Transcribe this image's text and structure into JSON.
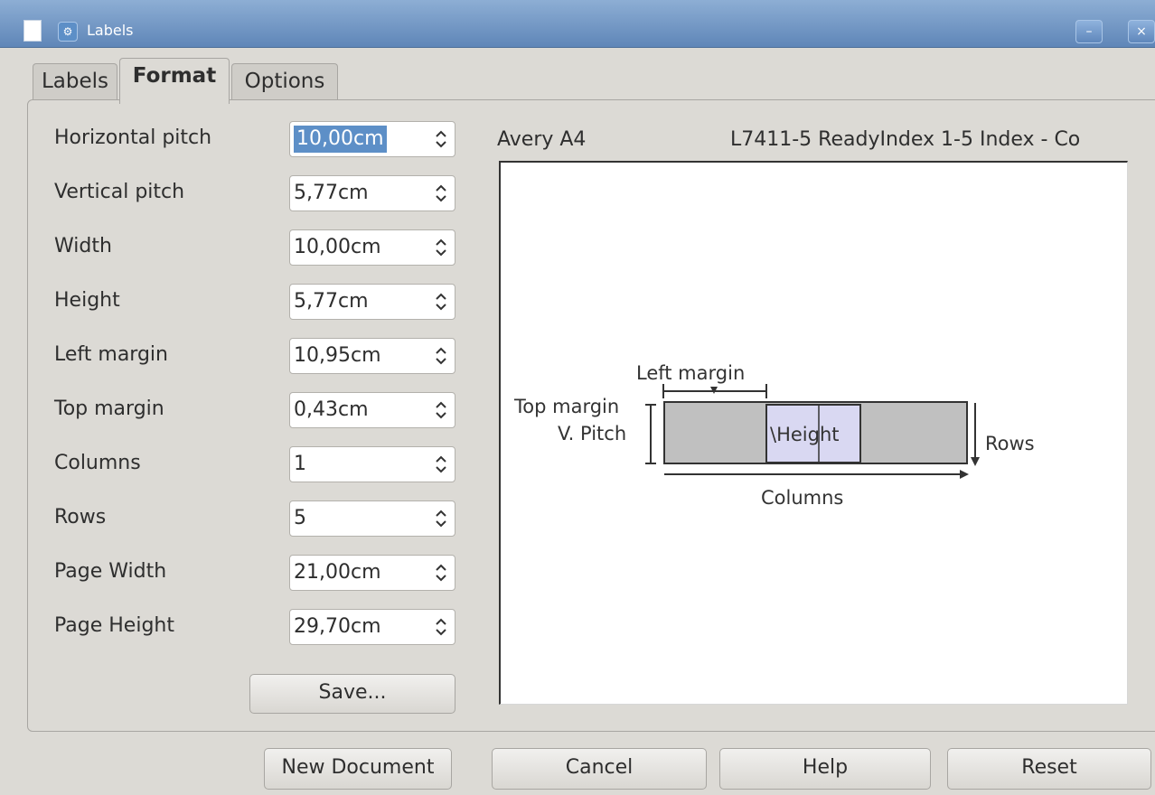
{
  "window": {
    "title": "Labels"
  },
  "tabs": [
    {
      "label": "Labels"
    },
    {
      "label": "Format"
    },
    {
      "label": "Options"
    }
  ],
  "fields": [
    {
      "label": "Horizontal pitch",
      "value": "10,00cm"
    },
    {
      "label": "Vertical pitch",
      "value": "5,77cm"
    },
    {
      "label": "Width",
      "value": "10,00cm"
    },
    {
      "label": "Height",
      "value": "5,77cm"
    },
    {
      "label": "Left margin",
      "value": "10,95cm"
    },
    {
      "label": "Top margin",
      "value": "0,43cm"
    },
    {
      "label": "Columns",
      "value": "1"
    },
    {
      "label": "Rows",
      "value": "5"
    },
    {
      "label": "Page Width",
      "value": "21,00cm"
    },
    {
      "label": "Page Height",
      "value": "29,70cm"
    }
  ],
  "save_button": "Save...",
  "preview": {
    "brand": "Avery A4",
    "product": "L7411-5 ReadyIndex 1-5 Index - Co",
    "left_margin": "Left margin",
    "top_margin": "Top margin",
    "v_pitch": "V. Pitch",
    "height": "\\Height",
    "rows": "Rows",
    "columns": "Columns"
  },
  "buttons": {
    "new_document": "New Document",
    "cancel": "Cancel",
    "help": "Help",
    "reset": "Reset"
  },
  "icons": {
    "spin": "up-down-spinner-icon",
    "document": "document-icon",
    "application": "application-icon",
    "minimize": "minimize-icon",
    "close": "close-icon"
  }
}
